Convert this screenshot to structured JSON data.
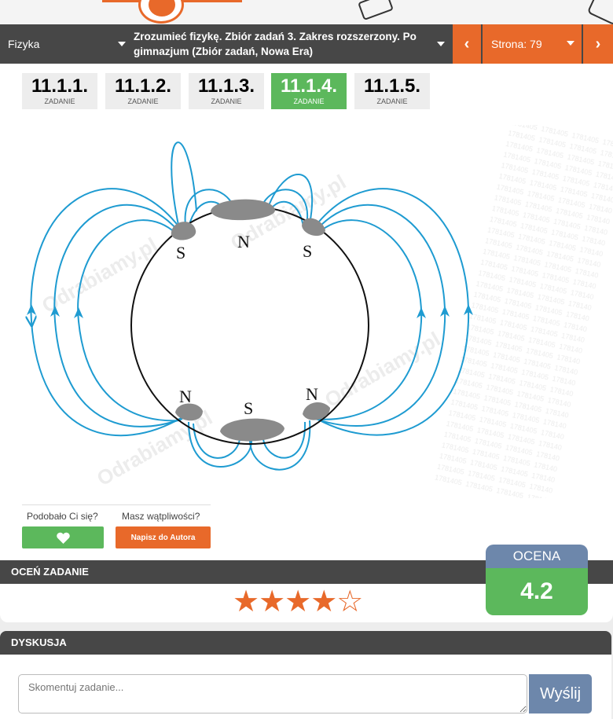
{
  "nav": {
    "subject": "Fizyka",
    "book": "Zrozumieć fizykę. Zbiór zadań 3. Zakres rozszerzony. Po gimnazjum (Zbiór zadań, Nowa Era)",
    "prev_icon": "chevron-left-icon",
    "page_label": "Strona: 79",
    "next_icon": "chevron-right-icon"
  },
  "tasks": [
    {
      "number": "11.1.1.",
      "label": "ZADANIE",
      "active": false
    },
    {
      "number": "11.1.2.",
      "label": "ZADANIE",
      "active": false
    },
    {
      "number": "11.1.3.",
      "label": "ZADANIE",
      "active": false
    },
    {
      "number": "11.1.4.",
      "label": "ZADANIE",
      "active": true
    },
    {
      "number": "11.1.5.",
      "label": "ZADANIE",
      "active": false
    }
  ],
  "figure": {
    "poles": {
      "top_left": "S",
      "top_center": "N",
      "top_right": "S",
      "bottom_left": "N",
      "bottom_center": "S",
      "bottom_right": "N"
    },
    "watermark": "Odrabiamy.pl",
    "line_color": "#1e9bd1"
  },
  "feedback": {
    "like_prompt": "Podobało Ci się?",
    "doubt_prompt": "Masz wątpliwości?",
    "like_icon": "heart-icon",
    "author_button": "Napisz do Autora"
  },
  "rating": {
    "title": "OCEŃ ZADANIE",
    "stars": "★★★★☆",
    "score_label": "OCENA",
    "score_value": "4.2"
  },
  "discussion": {
    "title": "DYSKUSJA",
    "placeholder": "Skomentuj zadanie...",
    "send_button": "Wyślij"
  },
  "colors": {
    "accent": "#e8692a",
    "green": "#5cb85c",
    "dark": "#474747",
    "score_blue": "#6d87ab"
  }
}
